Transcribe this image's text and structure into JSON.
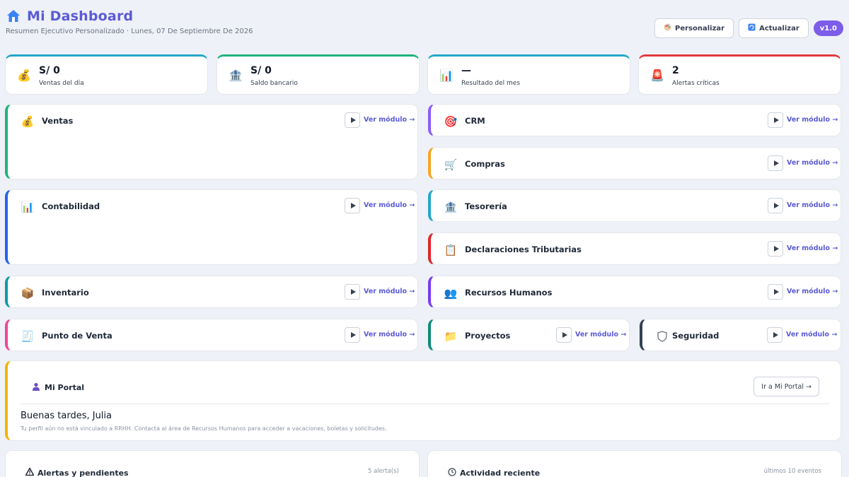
{
  "header": {
    "title": "Mi Dashboard",
    "subtitle": "Resumen Ejecutivo Personalizado · Lunes, 07 De Septiembre De 2026",
    "personalizar_label": "Personalizar",
    "actualizar_label": "Actualizar",
    "version": "v1.0"
  },
  "kpis": [
    {
      "value": "S/ 0",
      "label": "Ventas del día",
      "icon": "money-bag-icon",
      "color": "#22a7c9"
    },
    {
      "value": "S/ 0",
      "label": "Saldo bancario",
      "icon": "bank-icon",
      "color": "#1fb37a"
    },
    {
      "value": "—",
      "label": "Resultado del mes",
      "icon": "bar-chart-icon",
      "color": "#22a7c9"
    },
    {
      "value": "2",
      "label": "Alertas críticas",
      "icon": "siren-icon",
      "color": "#e0393e"
    }
  ],
  "modules": {
    "link_label": "Ver módulo →",
    "items": [
      {
        "title": "Ventas",
        "icon": "money-bag-icon",
        "color": "#1fb37a"
      },
      {
        "title": "CRM",
        "icon": "target-icon",
        "color": "#8b5cf6"
      },
      {
        "title": "Compras",
        "icon": "cart-icon",
        "color": "#f5a623"
      },
      {
        "title": "Contabilidad",
        "icon": "bar-chart-icon",
        "color": "#2563eb"
      },
      {
        "title": "Tesorería",
        "icon": "bank-icon",
        "color": "#22a7c9"
      },
      {
        "title": "Declaraciones Tributarias",
        "icon": "clipboard-icon",
        "color": "#dc2626"
      },
      {
        "title": "Inventario",
        "icon": "package-icon",
        "color": "#0e9aa7"
      },
      {
        "title": "Recursos Humanos",
        "icon": "people-icon",
        "color": "#7c3aed"
      },
      {
        "title": "Punto de Venta",
        "icon": "receipt-icon",
        "color": "#ec4899"
      },
      {
        "title": "Proyectos",
        "icon": "folder-icon",
        "color": "#0f8a7a"
      },
      {
        "title": "Seguridad",
        "icon": "shield-icon",
        "color": "#334155"
      }
    ]
  },
  "portal": {
    "title": "Mi Portal",
    "button_label": "Ir a Mi Portal →",
    "greeting": "Buenas tardes, Julia",
    "message": "Tu perfil aún no está vinculado a RRHH. Contacta al área de Recursos Humanos para acceder a vacaciones, boletas y solicitudes.",
    "color": "#f5b301"
  },
  "alerts": {
    "title": "Alertas y pendientes",
    "meta": "5 alerta(s)"
  },
  "activity": {
    "title": "Actividad reciente",
    "meta": "últimos 10 eventos"
  }
}
